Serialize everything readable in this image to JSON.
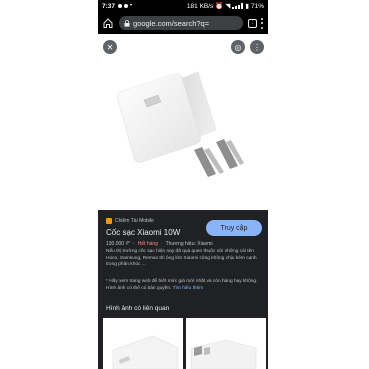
{
  "status_bar": {
    "time": "7:37",
    "network_speed": "181 KB/s",
    "battery": "71%"
  },
  "url_bar": {
    "url": "google.com/search?q="
  },
  "image_viewer": {
    "close_icon": "close-icon",
    "lens_icon": "lens-icon",
    "more_icon": "more-vert-icon"
  },
  "result": {
    "source": "Chiêm Tài Mobile",
    "visit_label": "Truy cập",
    "title": "Cốc sạc Xiaomi 10W",
    "price": "130.000 ₫*",
    "stock_status": "Hết hàng",
    "brand": "Thương hiệu: Xiaomi",
    "description": "Nếu thị trường cốc sạc hiện nay đã quá quen thuộc với những cái tên Hoco, Samsung, Remax thì ông lớn Xiaomi cũng không chịu kém cạnh trong phân khúc ...",
    "note": "* Hãy xem trang web để biết mức giá mới nhất và còn hàng hay không. Hình ảnh có thể có bản quyền.",
    "learn_more": "Tìm hiểu thêm"
  },
  "related": {
    "title": "Hình ảnh có liên quan"
  },
  "colors": {
    "accent": "#8ab4f8",
    "stock_status": "#f28b82",
    "background": "#202124"
  }
}
